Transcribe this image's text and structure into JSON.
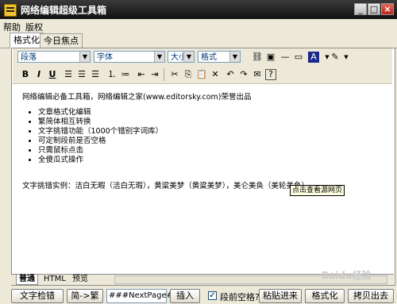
{
  "window": {
    "title": "网络编辑超级工具箱",
    "min_glyph": "_",
    "max_glyph": "□",
    "close_glyph": "×"
  },
  "menu": [
    "帮助",
    "版权"
  ],
  "top_tabs": [
    "格式化",
    "今日焦点"
  ],
  "toolbar": {
    "paragraph_select": "段落",
    "font_select": "字体",
    "size_select": "大小",
    "format_select": "格式"
  },
  "content": {
    "intro": "网络编辑必备工具箱，网络编辑之家(www.editorsky.com)荣誉出品",
    "features": [
      "文章格式化编辑",
      "繁简体相互转换",
      "文字挑错功能（1000个错别字词库）",
      "可定制段前是否空格",
      "只需鼠标点击",
      "全傻瓜式操作"
    ],
    "example": "文字挑错实例：洁白无暇（洁白无瑕），黄粱美梦（黄粱美梦），美仑美奂（美轮美奂）",
    "tooltip": "点击查看源网页"
  },
  "bottom_tabs": [
    "普通",
    "HTML",
    "预览"
  ],
  "buttons": {
    "proofread": "文字检错",
    "convert": "简->繁",
    "page_break_input": "###NextPage###",
    "insert": "插入",
    "indent_label": "段前空格?",
    "indent_checked": true,
    "paste": "粘贴进来",
    "format": "格式化",
    "copy_out": "拷贝出去"
  },
  "watermark": "Baidu经验"
}
